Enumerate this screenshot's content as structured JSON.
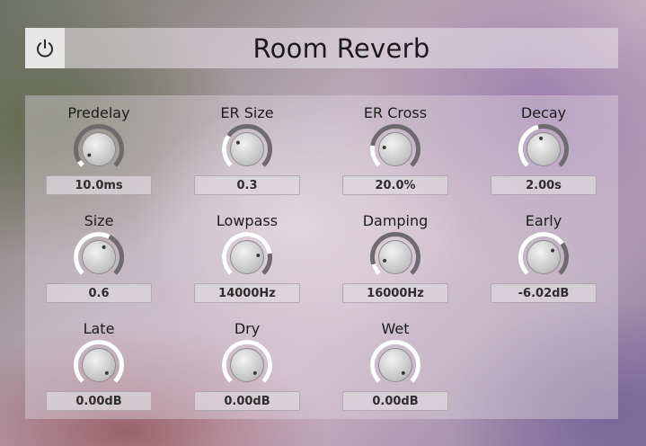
{
  "header": {
    "title": "Room Reverb",
    "power_icon": "power-icon"
  },
  "colors": {
    "knob_track": "#6e6a6e",
    "knob_active": "#ffffff",
    "knob_face": "#d8d8d8"
  },
  "knobs": [
    {
      "key": "predelay",
      "label": "Predelay",
      "value": "10.0ms",
      "level": 0.05
    },
    {
      "key": "er-size",
      "label": "ER Size",
      "value": "0.3",
      "level": 0.3
    },
    {
      "key": "er-cross",
      "label": "ER Cross",
      "value": "20.0%",
      "level": 0.2
    },
    {
      "key": "decay",
      "label": "Decay",
      "value": "2.00s",
      "level": 0.45
    },
    {
      "key": "size",
      "label": "Size",
      "value": "0.6",
      "level": 0.6
    },
    {
      "key": "lowpass",
      "label": "Lowpass",
      "value": "14000Hz",
      "level": 0.8
    },
    {
      "key": "damping",
      "label": "Damping",
      "value": "16000Hz",
      "level": 0.1
    },
    {
      "key": "early",
      "label": "Early",
      "value": "-6.02dB",
      "level": 0.7
    },
    {
      "key": "late",
      "label": "Late",
      "value": "0.00dB",
      "level": 1.0
    },
    {
      "key": "dry",
      "label": "Dry",
      "value": "0.00dB",
      "level": 1.0
    },
    {
      "key": "wet",
      "label": "Wet",
      "value": "0.00dB",
      "level": 1.0
    }
  ]
}
